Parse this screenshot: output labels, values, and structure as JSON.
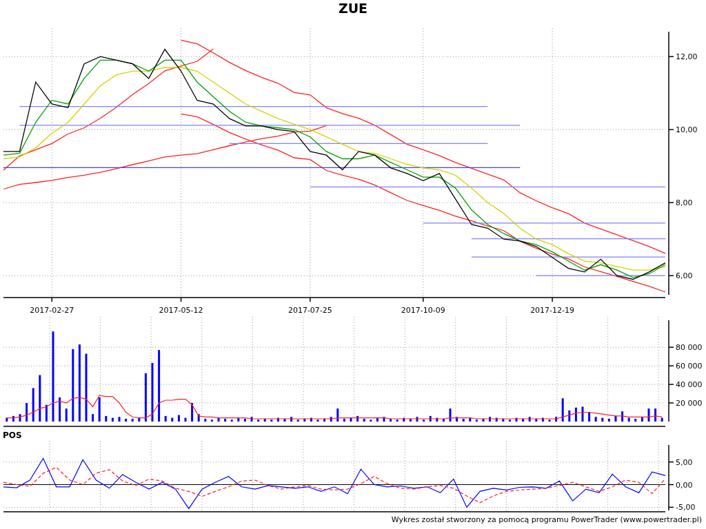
{
  "title": "ZUE",
  "price_chart": {
    "chart_data": {
      "type": "line",
      "grid": true,
      "ylim": [
        5.4,
        12.7
      ],
      "categories": [
        null,
        null,
        null,
        "2017-02-27",
        null,
        null,
        null,
        null,
        null,
        null,
        null,
        "2017-05-12",
        null,
        null,
        null,
        null,
        null,
        null,
        null,
        "2017-07-25",
        null,
        null,
        null,
        null,
        null,
        null,
        "2017-10-09",
        null,
        null,
        null,
        null,
        null,
        null,
        null,
        "2017-12-19",
        null,
        null,
        null,
        null,
        null,
        null,
        null
      ],
      "yticks": [
        {
          "value": 6,
          "label": "6,00"
        },
        {
          "value": 8,
          "label": "8,00"
        },
        {
          "value": 10,
          "label": "10,00"
        },
        {
          "value": 12,
          "label": "12,00"
        }
      ],
      "series": [
        {
          "color": "#000000",
          "values": [
            9.4,
            9.4,
            11.3,
            10.7,
            10.6,
            11.8,
            12.0,
            11.9,
            11.8,
            11.4,
            12.2,
            11.6,
            10.8,
            10.7,
            10.3,
            10.1,
            10.1,
            10.0,
            9.95,
            9.4,
            9.3,
            8.9,
            9.4,
            9.3,
            8.95,
            8.8,
            8.6,
            8.8,
            8.1,
            7.4,
            7.3,
            7.0,
            6.95,
            6.8,
            6.5,
            6.2,
            6.1,
            6.45,
            6.0,
            5.9,
            6.1,
            6.35
          ]
        },
        {
          "color": "#00a000",
          "values": [
            9.3,
            9.35,
            10.2,
            10.8,
            10.7,
            11.4,
            11.9,
            11.9,
            11.8,
            11.6,
            11.9,
            11.9,
            11.3,
            10.9,
            10.5,
            10.2,
            10.1,
            10.05,
            10.0,
            9.8,
            9.4,
            9.2,
            9.2,
            9.3,
            9.1,
            8.9,
            8.7,
            8.7,
            8.4,
            7.8,
            7.4,
            7.15,
            6.95,
            6.85,
            6.65,
            6.4,
            6.15,
            6.3,
            6.15,
            5.95,
            6.05,
            6.3
          ]
        },
        {
          "color": "#d4d400",
          "values": [
            9.2,
            9.25,
            9.5,
            9.9,
            10.2,
            10.7,
            11.2,
            11.5,
            11.6,
            11.6,
            11.7,
            11.7,
            11.6,
            11.3,
            11.0,
            10.7,
            10.5,
            10.3,
            10.15,
            10.0,
            9.8,
            9.6,
            9.4,
            9.35,
            9.2,
            9.05,
            8.95,
            8.9,
            8.75,
            8.4,
            8.0,
            7.7,
            7.3,
            7.0,
            6.85,
            6.6,
            6.4,
            6.35,
            6.25,
            6.15,
            6.15,
            6.25
          ]
        },
        {
          "color": "#8080ff",
          "values": [
            null,
            10.63,
            10.63,
            10.63,
            10.63,
            10.63,
            10.63,
            10.63,
            10.63,
            10.63,
            10.63,
            10.63,
            10.63,
            10.63,
            10.63,
            10.63,
            10.63,
            10.63,
            10.63,
            10.63,
            10.63,
            10.63,
            10.63,
            10.63,
            10.63,
            10.63,
            10.63,
            10.63,
            10.63,
            10.63,
            10.63,
            null,
            null,
            null,
            null,
            null,
            null,
            null,
            null,
            null,
            null,
            null
          ]
        },
        {
          "color": "#8080ff",
          "values": [
            null,
            10.12,
            10.12,
            10.12,
            10.12,
            10.12,
            10.12,
            10.12,
            10.12,
            10.12,
            10.12,
            10.12,
            10.12,
            10.12,
            10.12,
            10.12,
            10.12,
            10.12,
            10.12,
            10.12,
            10.12,
            10.12,
            10.12,
            10.12,
            10.12,
            10.12,
            10.12,
            10.12,
            10.12,
            10.12,
            10.12,
            10.12,
            10.12,
            null,
            null,
            null,
            null,
            null,
            null,
            null,
            null,
            null
          ]
        },
        {
          "color": "#8080ff",
          "values": [
            null,
            null,
            null,
            null,
            null,
            null,
            null,
            null,
            null,
            null,
            null,
            null,
            null,
            null,
            9.62,
            9.62,
            9.62,
            9.62,
            9.62,
            9.62,
            9.62,
            9.62,
            9.62,
            9.62,
            9.62,
            9.62,
            9.62,
            9.62,
            9.62,
            9.62,
            9.62,
            null,
            null,
            null,
            null,
            null,
            null,
            null,
            null,
            null,
            null,
            null
          ]
        },
        {
          "color": "#4040ff",
          "values": [
            8.96,
            8.96,
            8.96,
            8.96,
            8.96,
            8.96,
            8.96,
            8.96,
            8.96,
            8.96,
            8.96,
            8.96,
            8.96,
            8.96,
            8.96,
            8.96,
            8.96,
            8.96,
            8.96,
            8.96,
            8.96,
            8.96,
            8.96,
            8.96,
            8.96,
            8.96,
            8.96,
            8.96,
            8.96,
            8.96,
            8.96,
            8.96,
            8.96,
            null,
            null,
            null,
            null,
            null,
            null,
            null,
            null,
            null
          ]
        },
        {
          "color": "#8080ff",
          "values": [
            null,
            null,
            null,
            null,
            null,
            null,
            null,
            null,
            null,
            null,
            null,
            null,
            null,
            null,
            null,
            null,
            null,
            null,
            null,
            8.43,
            8.43,
            8.43,
            8.43,
            8.43,
            8.43,
            8.43,
            8.43,
            8.43,
            8.43,
            8.43,
            8.43,
            8.43,
            8.43,
            8.43,
            8.43,
            8.43,
            8.43,
            8.43,
            8.43,
            8.43,
            8.43,
            8.43
          ]
        },
        {
          "color": "#8080ff",
          "values": [
            null,
            null,
            null,
            null,
            null,
            null,
            null,
            null,
            null,
            null,
            null,
            null,
            null,
            null,
            null,
            null,
            null,
            null,
            null,
            null,
            null,
            null,
            null,
            null,
            null,
            null,
            7.44,
            7.44,
            7.44,
            7.44,
            7.44,
            7.44,
            7.44,
            7.44,
            7.44,
            7.44,
            7.44,
            7.44,
            7.44,
            7.44,
            7.44,
            7.44
          ]
        },
        {
          "color": "#8080ff",
          "values": [
            null,
            null,
            null,
            null,
            null,
            null,
            null,
            null,
            null,
            null,
            null,
            null,
            null,
            null,
            null,
            null,
            null,
            null,
            null,
            null,
            null,
            null,
            null,
            null,
            null,
            null,
            null,
            null,
            null,
            7.01,
            7.01,
            7.01,
            7.01,
            7.01,
            7.01,
            7.01,
            7.01,
            7.01,
            7.01,
            7.01,
            7.01,
            7.01
          ]
        },
        {
          "color": "#8080ff",
          "values": [
            null,
            null,
            null,
            null,
            null,
            null,
            null,
            null,
            null,
            null,
            null,
            null,
            null,
            null,
            null,
            null,
            null,
            null,
            null,
            null,
            null,
            null,
            null,
            null,
            null,
            null,
            null,
            null,
            null,
            6.51,
            6.51,
            6.51,
            6.51,
            6.51,
            6.51,
            6.51,
            6.51,
            6.51,
            6.51,
            6.51,
            6.51,
            6.51
          ]
        },
        {
          "color": "#8080ff",
          "values": [
            null,
            null,
            null,
            null,
            null,
            null,
            null,
            null,
            null,
            null,
            null,
            null,
            null,
            null,
            null,
            null,
            null,
            null,
            null,
            null,
            null,
            null,
            null,
            null,
            null,
            null,
            null,
            null,
            null,
            null,
            null,
            null,
            null,
            6.0,
            6.0,
            6.0,
            6.0,
            6.0,
            6.0,
            6.0,
            6.0,
            6.0
          ]
        },
        {
          "color": "#ff2020",
          "values": [
            8.89,
            9.28,
            9.45,
            9.62,
            9.88,
            10.05,
            10.31,
            10.61,
            10.96,
            11.26,
            11.61,
            11.74,
            11.87,
            12.21,
            null,
            null,
            null,
            null,
            null,
            null,
            null,
            null,
            null,
            null,
            null,
            null,
            null,
            null,
            null,
            null,
            null,
            null,
            null,
            null,
            null,
            null,
            null,
            null,
            null,
            null,
            null,
            null
          ]
        },
        {
          "color": "#ff2020",
          "values": [
            8.37,
            8.5,
            8.55,
            8.61,
            8.69,
            8.75,
            8.83,
            8.93,
            9.04,
            9.14,
            9.25,
            9.3,
            9.34,
            9.45,
            9.56,
            9.66,
            9.75,
            9.82,
            9.93,
            9.96,
            10.11,
            null,
            null,
            null,
            null,
            null,
            null,
            null,
            null,
            null,
            null,
            null,
            null,
            null,
            null,
            null,
            null,
            null,
            null,
            null,
            null,
            null
          ]
        },
        {
          "color": "#ff2020",
          "values": [
            null,
            null,
            null,
            null,
            null,
            null,
            null,
            null,
            null,
            null,
            null,
            12.45,
            12.35,
            12.1,
            11.84,
            11.62,
            11.43,
            11.27,
            11.02,
            10.95,
            10.6,
            10.44,
            10.31,
            10.12,
            9.86,
            9.6,
            9.45,
            9.29,
            9.1,
            8.94,
            8.78,
            8.62,
            8.27,
            8.05,
            7.86,
            7.7,
            7.44,
            7.28,
            7.12,
            6.96,
            6.8,
            6.61
          ]
        },
        {
          "color": "#ff2020",
          "values": [
            null,
            null,
            null,
            null,
            null,
            null,
            null,
            null,
            null,
            null,
            null,
            10.43,
            10.35,
            10.14,
            9.92,
            9.74,
            9.58,
            9.44,
            9.23,
            9.18,
            8.88,
            8.75,
            8.64,
            8.48,
            8.27,
            8.06,
            7.92,
            7.79,
            7.63,
            7.5,
            7.36,
            7.23,
            6.94,
            6.75,
            6.59,
            6.46,
            6.24,
            6.11,
            5.98,
            5.84,
            5.71,
            5.55
          ]
        }
      ]
    }
  },
  "volume_chart": {
    "chart_data": {
      "type": "bar",
      "grid": true,
      "ylim": [
        0,
        109000
      ],
      "yticks": [
        {
          "value": 20000,
          "label": "20 000"
        },
        {
          "value": 40000,
          "label": "40 000"
        },
        {
          "value": 60000,
          "label": "60 000"
        },
        {
          "value": 80000,
          "label": "80 000"
        }
      ],
      "series": [
        {
          "color": "#0000ff",
          "values": [
            4000,
            6000,
            8000,
            20000,
            36000,
            50000,
            18000,
            97000,
            26000,
            14000,
            78000,
            83000,
            73000,
            8000,
            26000,
            6000,
            4000,
            5000,
            3000,
            3000,
            4000,
            52000,
            63000,
            77000,
            6000,
            4000,
            7000,
            4000,
            20000,
            8000,
            3000,
            2000,
            4000,
            3000,
            2000,
            4000,
            3000,
            5000,
            2000,
            3000,
            2000,
            4000,
            3000,
            5000,
            2000,
            3000,
            4000,
            2000,
            3000,
            5000,
            14000,
            3000,
            4000,
            6000,
            3000,
            2000,
            4000,
            5000,
            3000,
            2000,
            4000,
            3000,
            5000,
            2000,
            6000,
            4000,
            3000,
            14000,
            5000,
            3000,
            4000,
            2000,
            3000,
            5000,
            4000,
            3000,
            2000,
            4000,
            3000,
            5000,
            3000,
            4000,
            2000,
            5000,
            25000,
            12000,
            15000,
            16000,
            10000,
            5000,
            4000,
            3000,
            6000,
            11000,
            4000,
            3000,
            5000,
            14000,
            14000,
            4000
          ]
        },
        {
          "type": "line",
          "color": "#ff2020",
          "values": [
            4000,
            4000,
            5000,
            7000,
            10000,
            14000,
            16000,
            20000,
            22000,
            20000,
            25000,
            26000,
            24000,
            16000,
            28000,
            27000,
            27000,
            20000,
            10000,
            5000,
            4000,
            4000,
            8000,
            20000,
            23000,
            23000,
            24000,
            24000,
            18000,
            6000,
            5000,
            5000,
            4000,
            4000,
            4000,
            4000,
            4000,
            3000,
            3000,
            3000,
            3000,
            3000,
            3000,
            3000,
            3000,
            3000,
            3000,
            3000,
            3000,
            3000,
            4000,
            4000,
            4000,
            4000,
            4000,
            4000,
            4000,
            4000,
            3000,
            3000,
            3000,
            3000,
            3000,
            3000,
            3000,
            3000,
            3000,
            4000,
            4000,
            4000,
            4000,
            3000,
            3000,
            3000,
            3000,
            3000,
            3000,
            3000,
            3000,
            3000,
            3000,
            3000,
            3000,
            3000,
            5000,
            7000,
            9000,
            10000,
            10000,
            9000,
            8000,
            7000,
            6000,
            6000,
            5000,
            5000,
            5000,
            5000,
            6000,
            5000
          ]
        }
      ]
    }
  },
  "oscillator": {
    "label": "POS",
    "chart_data": {
      "type": "line",
      "grid": true,
      "ylim": [
        -6,
        8.9
      ],
      "yticks": [
        {
          "value": -5,
          "label": "-5,00"
        },
        {
          "value": 0,
          "label": "0,00"
        },
        {
          "value": 5,
          "label": "5,00"
        }
      ],
      "series": [
        {
          "color": "#0000ff",
          "line_style": "solid",
          "values": [
            -0.5,
            -0.7,
            1.0,
            5.8,
            -0.5,
            -0.5,
            5.5,
            1.0,
            -0.8,
            2.2,
            0.5,
            -1.0,
            0.5,
            -1.0,
            -5.3,
            -1.0,
            0.5,
            1.8,
            -0.5,
            -1.0,
            -0.2,
            -0.5,
            -0.8,
            -0.5,
            -1.5,
            -0.5,
            -2.0,
            3.4,
            0.0,
            -0.5,
            -0.3,
            -0.8,
            -0.5,
            -1.8,
            1.2,
            -5.0,
            -1.5,
            -0.8,
            -1.2,
            -0.6,
            -0.5,
            -0.8,
            0.8,
            -3.6,
            -1.0,
            -1.8,
            2.3,
            -0.5,
            -1.8,
            2.8,
            2.0
          ]
        },
        {
          "color": "#ff2020",
          "line_style": "dashed",
          "values": [
            0.5,
            0.0,
            -0.4,
            2.5,
            3.8,
            1.0,
            0.0,
            2.5,
            3.3,
            0.8,
            -0.2,
            1.2,
            0.8,
            -0.8,
            -1.5,
            -2.6,
            -1.5,
            -0.5,
            0.8,
            1.0,
            -0.2,
            -1.0,
            -0.5,
            -0.2,
            -1.0,
            -1.2,
            -1.0,
            0.2,
            1.8,
            0.2,
            -0.8,
            -1.0,
            -0.5,
            -0.2,
            -0.8,
            -2.5,
            -4.0,
            -2.5,
            -1.5,
            -1.2,
            -1.0,
            -0.8,
            -0.2,
            0.5,
            -0.5,
            -1.5,
            -0.5,
            1.0,
            0.5,
            -2.0,
            1.3
          ]
        }
      ]
    }
  },
  "footer": "Wykres został stworzony za pomocą programu PowerTrader (www.powertrader.pl)"
}
